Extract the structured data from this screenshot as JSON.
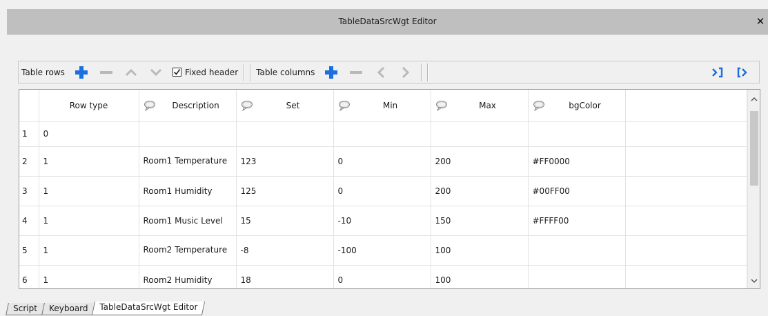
{
  "window": {
    "title": "TableDataSrcWgt Editor",
    "close_glyph": "✕"
  },
  "toolbar": {
    "rows_label": "Table rows",
    "fixed_header_label": "Fixed header",
    "fixed_header_checked": true,
    "columns_label": "Table columns",
    "icons": [
      "plus-icon",
      "minus-icon",
      "chevron-up-icon",
      "chevron-down-icon",
      "plus-icon",
      "minus-icon",
      "chevron-left-icon",
      "chevron-right-icon",
      "arrow-right-bar-icon",
      "bracket-arrow-right-icon"
    ]
  },
  "table": {
    "headers": [
      "Row type",
      "Description",
      "Set",
      "Min",
      "Max",
      "bgColor"
    ],
    "rows": [
      {
        "num": "1",
        "type": "0",
        "description": "",
        "set": "",
        "min": "",
        "max": "",
        "bgcolor": ""
      },
      {
        "num": "2",
        "type": "1",
        "description": "Room1 Temperature",
        "set": "123",
        "min": "0",
        "max": "200",
        "bgcolor": "#FF0000"
      },
      {
        "num": "3",
        "type": "1",
        "description": "Room1 Humidity",
        "set": "125",
        "min": "0",
        "max": "200",
        "bgcolor": "#00FF00"
      },
      {
        "num": "4",
        "type": "1",
        "description": "Room1 Music Level",
        "set": "15",
        "min": "-10",
        "max": "150",
        "bgcolor": "#FFFF00"
      },
      {
        "num": "5",
        "type": "1",
        "description": "Room2 Temperature",
        "set": "-8",
        "min": "-100",
        "max": "100",
        "bgcolor": ""
      },
      {
        "num": "6",
        "type": "1",
        "description": "Room2 Humidity",
        "set": "18",
        "min": "0",
        "max": "100",
        "bgcolor": ""
      }
    ]
  },
  "tabs": [
    "Script",
    "Keyboard",
    "TableDataSrcWgt Editor"
  ],
  "active_tab": "TableDataSrcWgt Editor",
  "colors": {
    "accent": "#1c6fe0",
    "titlebar": "#bfbfbf"
  }
}
